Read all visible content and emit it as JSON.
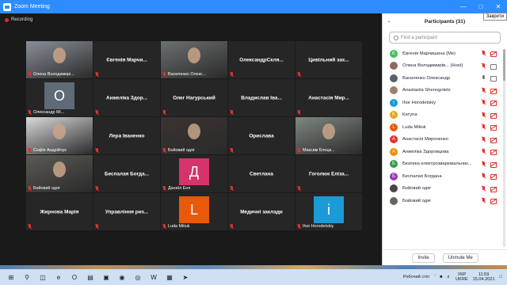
{
  "window": {
    "title": "Zoom Meeting",
    "tooltip": "Закрити",
    "minimize_icon": "minimize-icon",
    "maximize_icon": "maximize-icon",
    "close_icon": "close-icon"
  },
  "recording": {
    "label": "Recording",
    "color": "#e02828"
  },
  "tiles": [
    {
      "name": "Олена Володимирі...",
      "type": "video",
      "active": true,
      "bg": "#8a8f9a"
    },
    {
      "name": "Євгенія Марчи...",
      "type": "name"
    },
    {
      "name": "Василенко Олекс...",
      "type": "video",
      "bg": "#6b7070"
    },
    {
      "name": "ОлександрСкля...",
      "type": "name"
    },
    {
      "name": "Цивільний зах...",
      "type": "name"
    },
    {
      "name": "Олександр Мі...",
      "type": "avatar",
      "letter": "O",
      "avatar_color": "#5f6b76"
    },
    {
      "name": "Анжеліка Здор...",
      "type": "name"
    },
    {
      "name": "Олег Нагурський",
      "type": "name"
    },
    {
      "name": "Владислав Іва...",
      "type": "name"
    },
    {
      "name": "Анастасія Мир...",
      "type": "name"
    },
    {
      "name": "Софія Андрійчук",
      "type": "video",
      "bg": "#d9d9d9"
    },
    {
      "name": "Лера Іваненко",
      "type": "name"
    },
    {
      "name": "Бойовий одяг",
      "type": "video",
      "bg": "#3a3432"
    },
    {
      "name": "Орислава",
      "type": "name"
    },
    {
      "name": "Максим Блоцк...",
      "type": "video",
      "bg": "#7e8780"
    },
    {
      "name": "Бойовий одяг",
      "type": "video",
      "bg": "#5c5a55"
    },
    {
      "name": "Беспалая Богда...",
      "type": "name"
    },
    {
      "name": "Даниїл Еня",
      "type": "avatar",
      "letter": "Д",
      "avatar_color": "#d6336c"
    },
    {
      "name": "Светлана",
      "type": "name"
    },
    {
      "name": "Гоголюк Еліза...",
      "type": "name"
    },
    {
      "name": "Жирнова Марія",
      "type": "name"
    },
    {
      "name": "Управління риз...",
      "type": "name"
    },
    {
      "name": "Luda Mitiuk",
      "type": "avatar",
      "letter": "L",
      "avatar_color": "#e8590c"
    },
    {
      "name": "Медичні заклади",
      "type": "name"
    },
    {
      "name": "Ihor Horodetskiy",
      "type": "avatar",
      "letter": "i",
      "avatar_color": "#1c9ad6"
    }
  ],
  "participants_panel": {
    "title": "Participants (31)",
    "search_placeholder": "Find a participant",
    "invite_label": "Invite",
    "unmute_label": "Unmute Me",
    "rows": [
      {
        "name": "Євгенія Марчишена (Me)",
        "letter": "Є",
        "color": "#40c057",
        "mic": "off",
        "cam": "off"
      },
      {
        "name": "Олена Володимирів... (Host)",
        "letter": "",
        "color": "#8a6d5a",
        "mic": "off",
        "cam": "on"
      },
      {
        "name": "Василенко Олександр",
        "letter": "",
        "color": "#5a6068",
        "mic": "on",
        "cam": "on"
      },
      {
        "name": "Anastasiia Shenogolets",
        "letter": "",
        "color": "#9a8070",
        "mic": "off",
        "cam": "off"
      },
      {
        "name": "Ihor Horodetskiy",
        "letter": "i",
        "color": "#1c9ad6",
        "mic": "off",
        "cam": "off"
      },
      {
        "name": "Катуna",
        "letter": "K",
        "color": "#e8a317",
        "mic": "off",
        "cam": "off"
      },
      {
        "name": "Luda Mitiuk",
        "letter": "L",
        "color": "#e8590c",
        "mic": "off",
        "cam": "off"
      },
      {
        "name": "Анастасія Мироненко",
        "letter": "A",
        "color": "#e03131",
        "mic": "off",
        "cam": "off"
      },
      {
        "name": "Анжеліка Здоровцова",
        "letter": "A",
        "color": "#f08c00",
        "mic": "off",
        "cam": "off"
      },
      {
        "name": "Безпека електрозварювальник...",
        "letter": "Б",
        "color": "#2f9e44",
        "mic": "off",
        "cam": "off"
      },
      {
        "name": "Беспалая Богдана",
        "letter": "Б",
        "color": "#9c36b5",
        "mic": "off",
        "cam": "off"
      },
      {
        "name": "Бойовий одяг",
        "letter": "",
        "color": "#4a4444",
        "mic": "off",
        "cam": "off"
      },
      {
        "name": "Бойовий одяг",
        "letter": "",
        "color": "#6a6460",
        "mic": "off",
        "cam": "off"
      }
    ]
  },
  "taskbar": {
    "desktop_label": "Робочий стіл",
    "lang_top": "УКР",
    "lang_bottom": "UKRE",
    "time": "11:59",
    "date": "15.04.2021",
    "icons": [
      "search-icon",
      "task-view-icon",
      "edge-icon",
      "opera-icon",
      "folder-icon",
      "store-icon",
      "zoom-icon",
      "chrome-icon",
      "word-icon",
      "files-icon",
      "telegram-icon"
    ]
  }
}
